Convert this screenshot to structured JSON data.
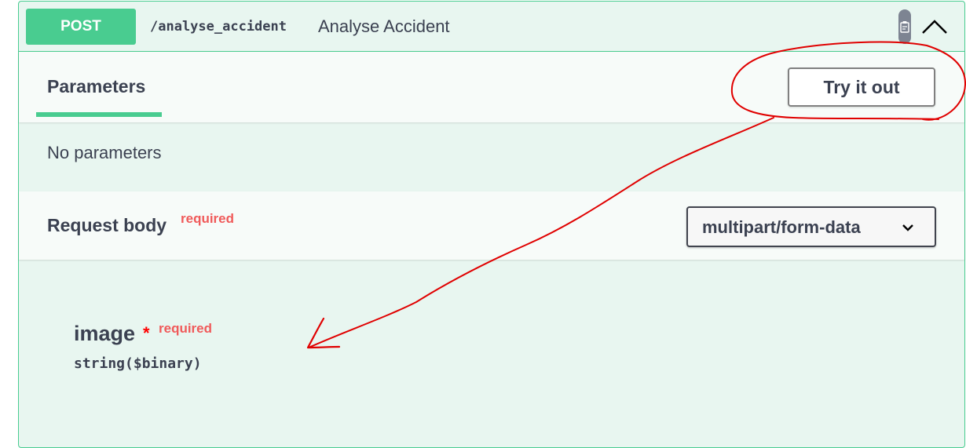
{
  "operation": {
    "method": "POST",
    "path": "/analyse_accident",
    "summary": "Analyse Accident"
  },
  "parameters": {
    "tab_label": "Parameters",
    "try_it_out_label": "Try it out",
    "empty_text": "No parameters"
  },
  "request_body": {
    "title": "Request body",
    "required_label": "required",
    "content_type": "multipart/form-data",
    "properties": [
      {
        "name": "image",
        "required_star": "*",
        "required_label": "required",
        "type": "string($binary)"
      }
    ]
  },
  "icons": {
    "copy": "clipboard-icon",
    "collapse": "chevron-up-icon",
    "dropdown": "chevron-down-icon"
  },
  "colors": {
    "post_accent": "#49cc90",
    "block_background": "#e8f6f0",
    "required": "#f05a5a",
    "text": "#3b4151",
    "annotation": "#e00000"
  }
}
